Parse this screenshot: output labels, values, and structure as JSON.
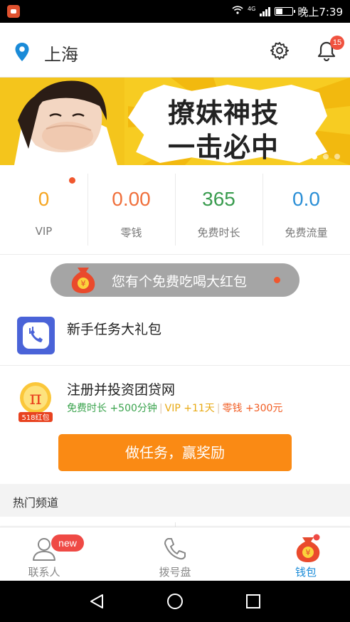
{
  "status_bar": {
    "network": "4G",
    "time": "晚上7:39"
  },
  "header": {
    "city": "上海",
    "notification_count": "15"
  },
  "banner": {
    "slogan_line1": "撩妹神技",
    "slogan_line2": "一击必中",
    "dots_count": 5,
    "active_dot": 3
  },
  "stats": [
    {
      "value": "0",
      "label": "VIP",
      "color": "#f5a623"
    },
    {
      "value": "0.00",
      "label": "零钱",
      "color": "#f0703c"
    },
    {
      "value": "365",
      "label": "免费时长",
      "color": "#3a9c4f"
    },
    {
      "value": "0.0",
      "label": "免费流量",
      "color": "#2b8fd6"
    }
  ],
  "red_packet": {
    "text": "您有个免费吃喝大红包"
  },
  "tasks": [
    {
      "title": "新手任务大礼包"
    },
    {
      "title": "注册并投资团贷网",
      "icon_label": "518红包",
      "rewards": [
        {
          "label": "免费时长",
          "value": "+500分钟"
        },
        {
          "label": "VIP",
          "value": "+11天"
        },
        {
          "label": "零钱",
          "value": "+300元"
        }
      ]
    }
  ],
  "cta_label": "做任务，赢奖励",
  "section_title": "热门频道",
  "tabs": [
    {
      "label": "联系人",
      "badge": "new"
    },
    {
      "label": "拨号盘"
    },
    {
      "label": "钱包"
    }
  ],
  "colors": {
    "accent": "#1a8bd8",
    "cta": "#fa8a14",
    "badge": "#ef4a45"
  }
}
